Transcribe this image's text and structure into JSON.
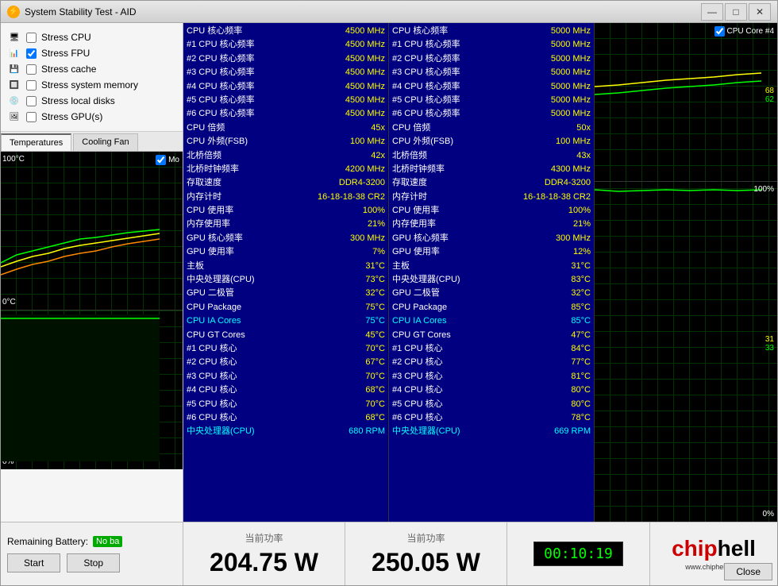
{
  "window": {
    "title": "System Stability Test - AID",
    "min_btn": "—",
    "max_btn": "□",
    "close_btn": "✕"
  },
  "stress_options": {
    "items": [
      {
        "id": "stress-cpu",
        "label": "Stress CPU",
        "checked": false,
        "icon": "cpu"
      },
      {
        "id": "stress-fpu",
        "label": "Stress FPU",
        "checked": true,
        "icon": "fpu"
      },
      {
        "id": "stress-cache",
        "label": "Stress cache",
        "checked": false,
        "icon": "cache"
      },
      {
        "id": "stress-memory",
        "label": "Stress system memory",
        "checked": false,
        "icon": "memory"
      },
      {
        "id": "stress-local",
        "label": "Stress local disks",
        "checked": false,
        "icon": "disk"
      },
      {
        "id": "stress-gpu",
        "label": "Stress GPU(s)",
        "checked": false,
        "icon": "gpu"
      }
    ]
  },
  "tabs": {
    "items": [
      {
        "id": "temperatures",
        "label": "Temperatures",
        "active": true
      },
      {
        "id": "cooling-fan",
        "label": "Cooling Fan",
        "active": false
      }
    ]
  },
  "graph_top": {
    "label_top": "100°C",
    "label_bottom": "0°C",
    "checkbox_label": "Mo"
  },
  "graph_bottom": {
    "label_top": "100%",
    "label_bottom": "0%"
  },
  "col1": {
    "rows": [
      {
        "label": "CPU 核心频率",
        "value": "4500 MHz"
      },
      {
        "label": "#1 CPU 核心频率",
        "value": "4500 MHz"
      },
      {
        "label": "#2 CPU 核心频率",
        "value": "4500 MHz"
      },
      {
        "label": "#3 CPU 核心频率",
        "value": "4500 MHz"
      },
      {
        "label": "#4 CPU 核心频率",
        "value": "4500 MHz"
      },
      {
        "label": "#5 CPU 核心频率",
        "value": "4500 MHz"
      },
      {
        "label": "#6 CPU 核心频率",
        "value": "4500 MHz"
      },
      {
        "label": "CPU 倍频",
        "value": "45x"
      },
      {
        "label": "CPU 外频(FSB)",
        "value": "100 MHz"
      },
      {
        "label": "北桥倍频",
        "value": "42x"
      },
      {
        "label": "北桥时钟频率",
        "value": "4200 MHz"
      },
      {
        "label": "存取速度",
        "value": "DDR4-3200"
      },
      {
        "label": "内存计时",
        "value": "16-18-18-38 CR2"
      },
      {
        "label": "CPU 使用率",
        "value": "100%"
      },
      {
        "label": "内存使用率",
        "value": "21%"
      },
      {
        "label": "GPU 核心频率",
        "value": "300 MHz"
      },
      {
        "label": "GPU 使用率",
        "value": "7%"
      },
      {
        "label": "主板",
        "value": "31°C"
      },
      {
        "label": "中央处理器(CPU)",
        "value": "73°C"
      },
      {
        "label": "GPU 二极管",
        "value": "32°C"
      },
      {
        "label": "CPU Package",
        "value": "75°C"
      },
      {
        "label": "CPU IA Cores",
        "value": "75°C",
        "highlight": true
      },
      {
        "label": "CPU GT Cores",
        "value": "45°C"
      },
      {
        "label": "#1 CPU 核心",
        "value": "70°C"
      },
      {
        "label": "#2 CPU 核心",
        "value": "67°C"
      },
      {
        "label": "#3 CPU 核心",
        "value": "70°C"
      },
      {
        "label": "#4 CPU 核心",
        "value": "68°C"
      },
      {
        "label": "#5 CPU 核心",
        "value": "70°C"
      },
      {
        "label": "#6 CPU 核心",
        "value": "68°C"
      },
      {
        "label": "中央处理器(CPU)",
        "value": "680 RPM",
        "bottom": true
      }
    ]
  },
  "col2": {
    "rows": [
      {
        "label": "CPU 核心频率",
        "value": "5000 MHz"
      },
      {
        "label": "#1 CPU 核心频率",
        "value": "5000 MHz"
      },
      {
        "label": "#2 CPU 核心频率",
        "value": "5000 MHz"
      },
      {
        "label": "#3 CPU 核心频率",
        "value": "5000 MHz"
      },
      {
        "label": "#4 CPU 核心频率",
        "value": "5000 MHz"
      },
      {
        "label": "#5 CPU 核心频率",
        "value": "5000 MHz"
      },
      {
        "label": "#6 CPU 核心频率",
        "value": "5000 MHz"
      },
      {
        "label": "CPU 倍频",
        "value": "50x"
      },
      {
        "label": "CPU 外频(FSB)",
        "value": "100 MHz"
      },
      {
        "label": "北桥倍频",
        "value": "43x"
      },
      {
        "label": "北桥时钟频率",
        "value": "4300 MHz"
      },
      {
        "label": "存取速度",
        "value": "DDR4-3200"
      },
      {
        "label": "内存计时",
        "value": "16-18-18-38 CR2"
      },
      {
        "label": "CPU 使用率",
        "value": "100%"
      },
      {
        "label": "内存使用率",
        "value": "21%"
      },
      {
        "label": "GPU 核心频率",
        "value": "300 MHz"
      },
      {
        "label": "GPU 使用率",
        "value": "12%"
      },
      {
        "label": "主板",
        "value": "31°C"
      },
      {
        "label": "中央处理器(CPU)",
        "value": "83°C"
      },
      {
        "label": "GPU 二极管",
        "value": "32°C"
      },
      {
        "label": "CPU Package",
        "value": "85°C"
      },
      {
        "label": "CPU IA Cores",
        "value": "85°C",
        "highlight": true
      },
      {
        "label": "CPU GT Cores",
        "value": "47°C"
      },
      {
        "label": "#1 CPU 核心",
        "value": "84°C"
      },
      {
        "label": "#2 CPU 核心",
        "value": "77°C"
      },
      {
        "label": "#3 CPU 核心",
        "value": "81°C"
      },
      {
        "label": "#4 CPU 核心",
        "value": "80°C"
      },
      {
        "label": "#5 CPU 核心",
        "value": "80°C"
      },
      {
        "label": "#6 CPU 核心",
        "value": "78°C"
      },
      {
        "label": "中央处理器(CPU)",
        "value": "669 RPM",
        "bottom": true
      }
    ]
  },
  "temp_graph": {
    "checkbox_label": "CPU Core #4",
    "values": [
      "68",
      "62"
    ],
    "bottom_values": [
      "31",
      "33"
    ]
  },
  "bottom": {
    "battery_label": "Remaining Battery:",
    "battery_value": "No ba",
    "start_btn": "Start",
    "stop_btn": "Stop",
    "power1_label": "当前功率",
    "power1_value": "204.75 W",
    "power2_label": "当前功率",
    "power2_value": "250.05 W",
    "timer": "00:10:19",
    "logo_chip": "chip",
    "logo_hell": "hell",
    "logo_url": "www.chiphell.com",
    "close_btn": "Close"
  }
}
